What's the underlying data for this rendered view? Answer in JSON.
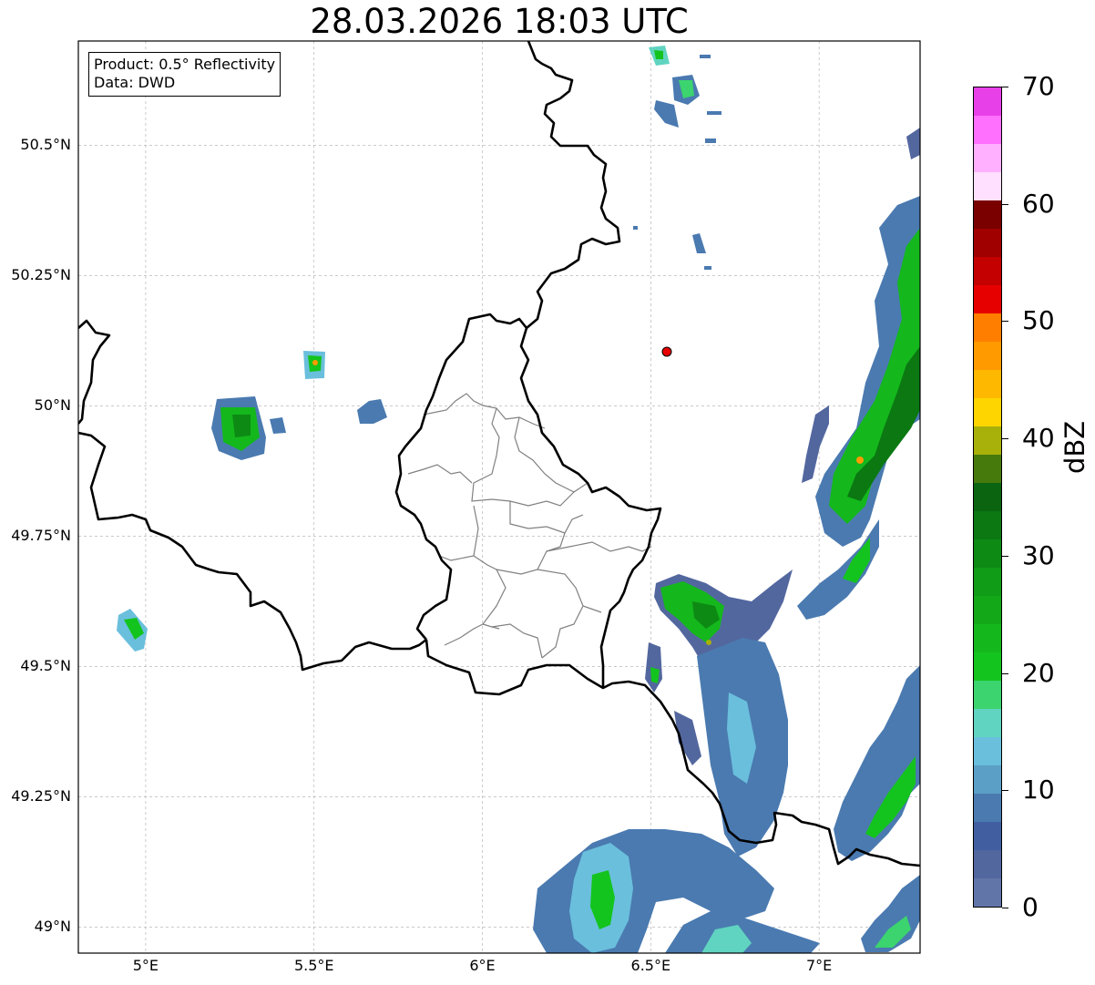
{
  "title": "28.03.2026 18:03 UTC",
  "info_box": {
    "product": "Product: 0.5° Reflectivity",
    "source": "Data: DWD"
  },
  "map": {
    "lon_range": [
      4.8,
      7.3
    ],
    "lat_range": [
      48.95,
      50.7
    ],
    "grid": true,
    "lat_ticks": [
      {
        "value": 50.5,
        "label": "50.5°N"
      },
      {
        "value": 50.25,
        "label": "50.25°N"
      },
      {
        "value": 50.0,
        "label": "50°N"
      },
      {
        "value": 49.75,
        "label": "49.75°N"
      },
      {
        "value": 49.5,
        "label": "49.5°N"
      },
      {
        "value": 49.25,
        "label": "49.25°N"
      },
      {
        "value": 49.0,
        "label": "49°N"
      }
    ],
    "lon_ticks": [
      {
        "value": 5.0,
        "label": "5°E"
      },
      {
        "value": 5.5,
        "label": "5.5°E"
      },
      {
        "value": 6.0,
        "label": "6°E"
      },
      {
        "value": 6.5,
        "label": "6.5°E"
      },
      {
        "value": 7.0,
        "label": "7°E"
      }
    ],
    "radar_site": {
      "lon": 6.548,
      "lat": 50.11
    }
  },
  "colorbar": {
    "label": "dBZ",
    "min": 0,
    "max": 70,
    "ticks": [
      "0",
      "10",
      "20",
      "30",
      "40",
      "50",
      "60",
      "70"
    ],
    "colors": [
      "#6175a8",
      "#53679f",
      "#415fa0",
      "#4a7ab0",
      "#5c9fc6",
      "#6abfdc",
      "#60d4c0",
      "#3bd46e",
      "#14c41e",
      "#14b81c",
      "#12a818",
      "#109c16",
      "#0d8a14",
      "#0b7812",
      "#0a6410",
      "#467a0c",
      "#a8b00a",
      "#ffd500",
      "#ffb800",
      "#ff9a00",
      "#ff7e00",
      "#e60000",
      "#c40000",
      "#a00000",
      "#7a0000",
      "#ffe0ff",
      "#ffb0ff",
      "#ff70ff",
      "#e840e8"
    ]
  }
}
